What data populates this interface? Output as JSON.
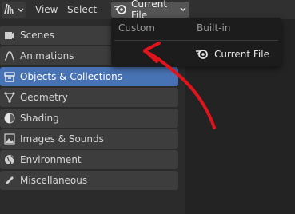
{
  "header": {
    "editor_type_icon": "outliner-editor-icon",
    "menus": [
      "View",
      "Select"
    ],
    "filter_button": {
      "icon": "blender-logo-icon",
      "label": "Current File"
    }
  },
  "sidebar": {
    "items": [
      {
        "label": "Scenes",
        "icon": "scenes-icon",
        "active": false
      },
      {
        "label": "Animations",
        "icon": "animation-curve-icon",
        "active": false
      },
      {
        "label": "Objects & Collections",
        "icon": "collection-box-icon",
        "active": true
      },
      {
        "label": "Geometry",
        "icon": "geometry-nodes-icon",
        "active": false
      },
      {
        "label": "Shading",
        "icon": "shading-sphere-icon",
        "active": false
      },
      {
        "label": "Images & Sounds",
        "icon": "image-icon",
        "active": false
      },
      {
        "label": "Environment",
        "icon": "world-globe-icon",
        "active": false
      },
      {
        "label": "Miscellaneous",
        "icon": "pencil-icon",
        "active": false
      }
    ]
  },
  "dropdown": {
    "custom_header": "Custom",
    "builtin_header": "Built-in",
    "builtin_items": [
      {
        "icon": "blender-logo-icon",
        "label": "Current File"
      }
    ]
  },
  "annotation": {
    "type": "hand-drawn-arrow",
    "color": "#e0141c"
  },
  "colors": {
    "accent": "#4772b3",
    "panel": "#3d3d3d",
    "background": "#2b2b2b",
    "menu": "#1c1c1c"
  }
}
